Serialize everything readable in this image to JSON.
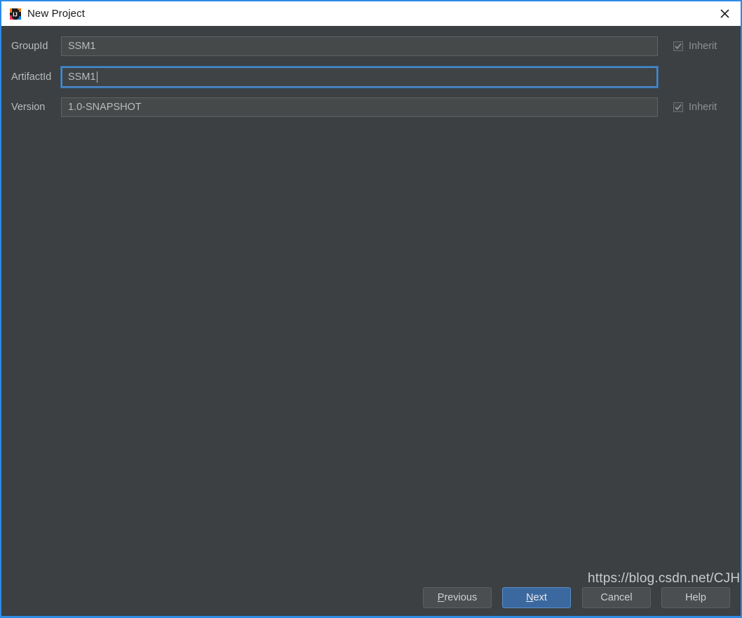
{
  "window": {
    "title": "New Project",
    "icon": "intellij-idea-icon",
    "close_icon": "close-icon",
    "accent_color": "#2e8ae6",
    "titlebar_bg": "#ffffff",
    "panel_bg": "#3c4043"
  },
  "form": {
    "fields": [
      {
        "label": "GroupId",
        "value": "SSM1",
        "focused": false,
        "inherit": {
          "label": "Inherit",
          "checked": true,
          "enabled": false
        }
      },
      {
        "label": "ArtifactId",
        "value": "SSM1",
        "focused": true,
        "inherit": null
      },
      {
        "label": "Version",
        "value": "1.0-SNAPSHOT",
        "focused": false,
        "inherit": {
          "label": "Inherit",
          "checked": true,
          "enabled": false
        }
      }
    ]
  },
  "buttons": {
    "previous": {
      "label": "Previous",
      "mnemonic": "P",
      "rest": "revious",
      "primary": false
    },
    "next": {
      "label": "Next",
      "mnemonic": "N",
      "rest": "ext",
      "primary": true,
      "color": "#3b689f"
    },
    "cancel": {
      "label": "Cancel",
      "mnemonic": "",
      "rest": "Cancel",
      "primary": false
    },
    "help": {
      "label": "Help",
      "mnemonic": "",
      "rest": "Help",
      "primary": false
    }
  },
  "watermark": {
    "text": "https://blog.csdn.net/CJHCN"
  }
}
